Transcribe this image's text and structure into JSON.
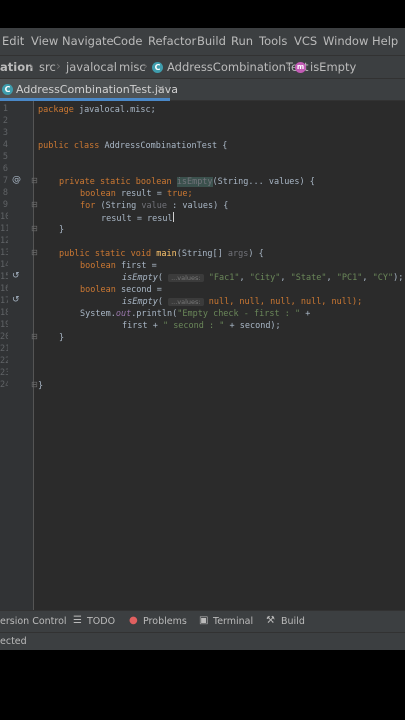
{
  "menu": [
    "Edit",
    "View",
    "Navigate",
    "Code",
    "Refactor",
    "Build",
    "Run",
    "Tools",
    "VCS",
    "Window",
    "Help"
  ],
  "breadcrumb": {
    "project": "ation",
    "items": [
      "src",
      "javalocal",
      "misc"
    ],
    "class_name": "AddressCombinationTest",
    "method_name": "isEmpty",
    "class_icon": "C",
    "method_icon": "m"
  },
  "tab": {
    "label": "AddressCombinationTest.java",
    "close": "×",
    "icon": "C"
  },
  "gutter": {
    "line_numbers": [
      "1",
      "2",
      "3",
      "4",
      "5",
      "6",
      "7",
      "8",
      "9",
      "10",
      "11",
      "12",
      "13",
      "14",
      "15",
      "16",
      "17",
      "18",
      "19",
      "20",
      "21",
      "22",
      "23",
      "24"
    ],
    "icons": {
      "at": "@",
      "run": "↺"
    }
  },
  "code": {
    "l1_kw": "package",
    "l1_rest": " javalocal.misc;",
    "l4_kw": "public class",
    "l4_name": " AddressCombinationTest {",
    "l7_kw": "private static boolean",
    "l7_sp": " ",
    "l7_fn": "isEmpty",
    "l7_p1": "(String... values) {",
    "l8_kw": "boolean",
    "l8_rest": " result = ",
    "l8_kw2": "true",
    "l8_end": ";",
    "l9_kw": "for",
    "l9_a": " (String ",
    "l9_var": "value",
    "l9_b": " : values) {",
    "l10": "result = resul",
    "l11": "}",
    "l13_kw": "public static void",
    "l13_fn": " main",
    "l13_a": "(String[] ",
    "l13_arg": "args",
    "l13_b": ") {",
    "l14_kw": "boolean",
    "l14_rest": " first =",
    "l15_fn": "isEmpty",
    "l15_a": "( ",
    "l15_hint": "...values:",
    "l15_s1": "\"Fac1\"",
    "l15_s2": "\"City\"",
    "l15_s3": "\"State\"",
    "l15_s4": "\"PC1\"",
    "l15_s5": "\"CY\"",
    "l15_comma": ", ",
    "l15_end": ");",
    "l16_kw": "boolean",
    "l16_rest": " second =",
    "l17_fn": "isEmpty",
    "l17_a": "( ",
    "l17_hint": "...values:",
    "l17_nulls": " null, null, null, null, null);",
    "l18_a": "System.",
    "l18_out": "out",
    "l18_b": ".println(",
    "l18_s": "\"Empty check - first : \"",
    "l18_c": " +",
    "l19_a": "first + ",
    "l19_s": "\" second : \"",
    "l19_b": " + second);",
    "l20": "}",
    "l23": "}"
  },
  "toolwindows": {
    "version_control": "ersion Control",
    "todo": "TODO",
    "problems": "Problems",
    "terminal": "Terminal",
    "build": "Build"
  },
  "status": {
    "text": "ected"
  },
  "colors": {
    "background": "#2b2b2b",
    "keyword": "#cc7832",
    "string": "#6a8759",
    "function": "#ffc66d",
    "accent": "#4a88c7"
  }
}
